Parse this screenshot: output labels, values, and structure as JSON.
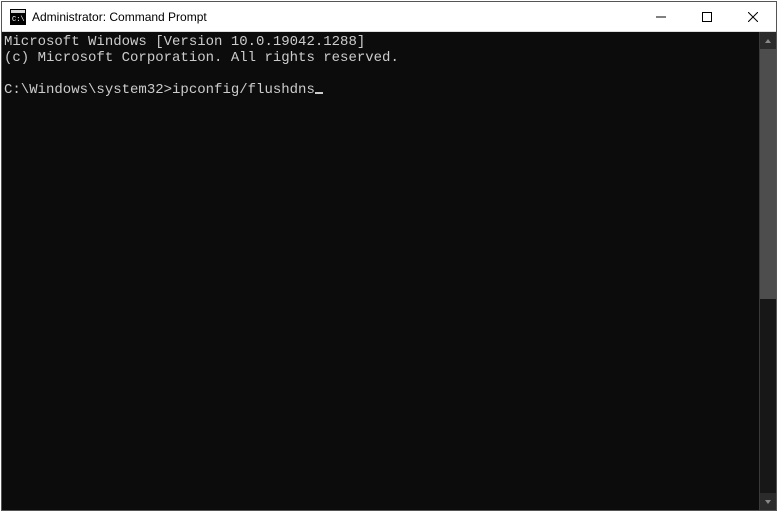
{
  "window": {
    "title": "Administrator: Command Prompt"
  },
  "terminal": {
    "line1": "Microsoft Windows [Version 10.0.19042.1288]",
    "line2": "(c) Microsoft Corporation. All rights reserved.",
    "blank": "",
    "prompt": "C:\\Windows\\system32>",
    "input": "ipconfig/flushdns"
  }
}
